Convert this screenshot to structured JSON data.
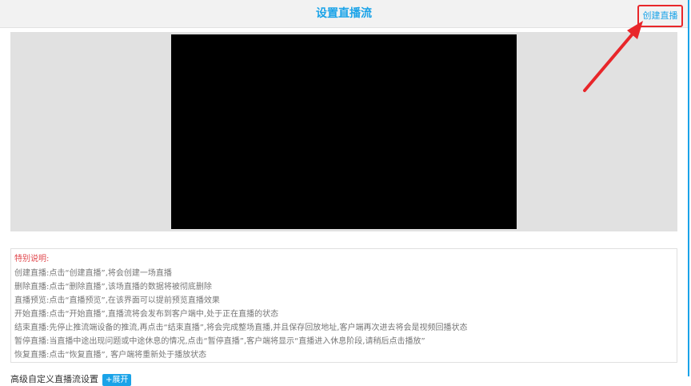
{
  "header": {
    "title": "设置直播流",
    "create_link": "创建直播"
  },
  "notes": {
    "title": "特别说明:",
    "lines": [
      "创建直播:点击“创建直播”,将会创建一场直播",
      "删除直播:点击“删除直播”,该场直播的数据将被彻底删除",
      "直播预览:点击“直播预览”,在该界面可以提前预览直播效果",
      "开始直播:点击“开始直播”,直播流将会发布到客户端中,处于正在直播的状态",
      "结束直播:先停止推流端设备的推流,再点击“结束直播”,将会完成整场直播,并且保存回放地址,客户端再次进去将会是视频回播状态",
      "暂停直播:当直播中途出现问题或中途休息的情况,点击“暂停直播”,客户端将显示“直播进入休息阶段,请稍后点击播放”",
      "恢复直播:点击“恢复直播”, 客户端将重新处于播放状态"
    ]
  },
  "advanced": {
    "label": "高级自定义直播流设置",
    "expand_button": "+展开"
  },
  "colors": {
    "accent": "#1aa3e8",
    "annotation_red": "#e8262a",
    "notes_title": "#e0474c"
  }
}
